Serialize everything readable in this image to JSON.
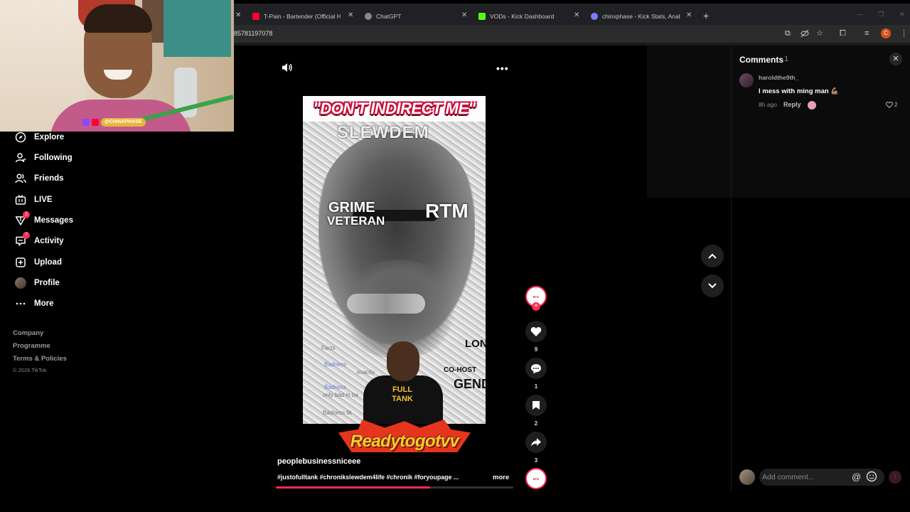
{
  "browser": {
    "tabs": [
      {
        "title": "T-Pain - Bartender (Official HD",
        "fav_color": "#ff0033"
      },
      {
        "title": "ChatGPT",
        "fav_color": "#888888"
      },
      {
        "title": "VODs - Kick Dashboard",
        "fav_color": "#53fc18"
      },
      {
        "title": "chinxphase - Kick Stats, Analytic",
        "fav_color": "#7b7bff"
      }
    ],
    "url": "85781197078",
    "profile_initial": "C"
  },
  "webcam": {
    "overlay_name": "@CHINXPHASE"
  },
  "sidebar": {
    "items": [
      {
        "label": "Explore",
        "icon": "compass-icon"
      },
      {
        "label": "Following",
        "icon": "user-follow-icon"
      },
      {
        "label": "Friends",
        "icon": "friends-icon"
      },
      {
        "label": "LIVE",
        "icon": "live-tv-icon"
      },
      {
        "label": "Messages",
        "icon": "messages-icon",
        "badge": "2"
      },
      {
        "label": "Activity",
        "icon": "activity-icon",
        "badge": "7"
      },
      {
        "label": "Upload",
        "icon": "upload-icon"
      },
      {
        "label": "Profile",
        "icon": "avatar-icon"
      },
      {
        "label": "More",
        "icon": "more-dots-icon"
      }
    ],
    "footer": [
      "Company",
      "Programme",
      "Terms & Policies"
    ],
    "copyright": "© 2026 TikTok"
  },
  "video": {
    "title_overlay": "\"DON'T INDIRECT ME\"",
    "text_grime": "GRIME",
    "text_veteran": "VETERAN",
    "text_rtm": "RTM",
    "text_slewdem": "SLEWDEM",
    "text_legendary": "GENDAR",
    "text_cohost": "CO-HOST",
    "text_london": "LOND",
    "chat_lines": [
      "Facts",
      "Badness",
      "exactly",
      "Badness",
      "only bad in ba",
      "Badness lik"
    ],
    "shirt_text": "FULL TANK",
    "logo_text": "Readytogotvv",
    "author": "peoplebusinessniceee",
    "caption": "#justofulltank #chronikslewdem4life #chronik #foryoupage ...",
    "more_label": "more",
    "progress": 0.65
  },
  "actions": {
    "like_count": "9",
    "comment_count": "1",
    "save_count": "2",
    "share_count": "3"
  },
  "comments": {
    "title": "Comments",
    "count": "1",
    "items": [
      {
        "user": "haroldthe9th_",
        "text": "I mess with ming man 💪🏽",
        "time": "8h ago",
        "reply_label": "Reply",
        "likes": "2"
      }
    ],
    "input_placeholder": "Add comment...",
    "at_symbol": "@"
  }
}
